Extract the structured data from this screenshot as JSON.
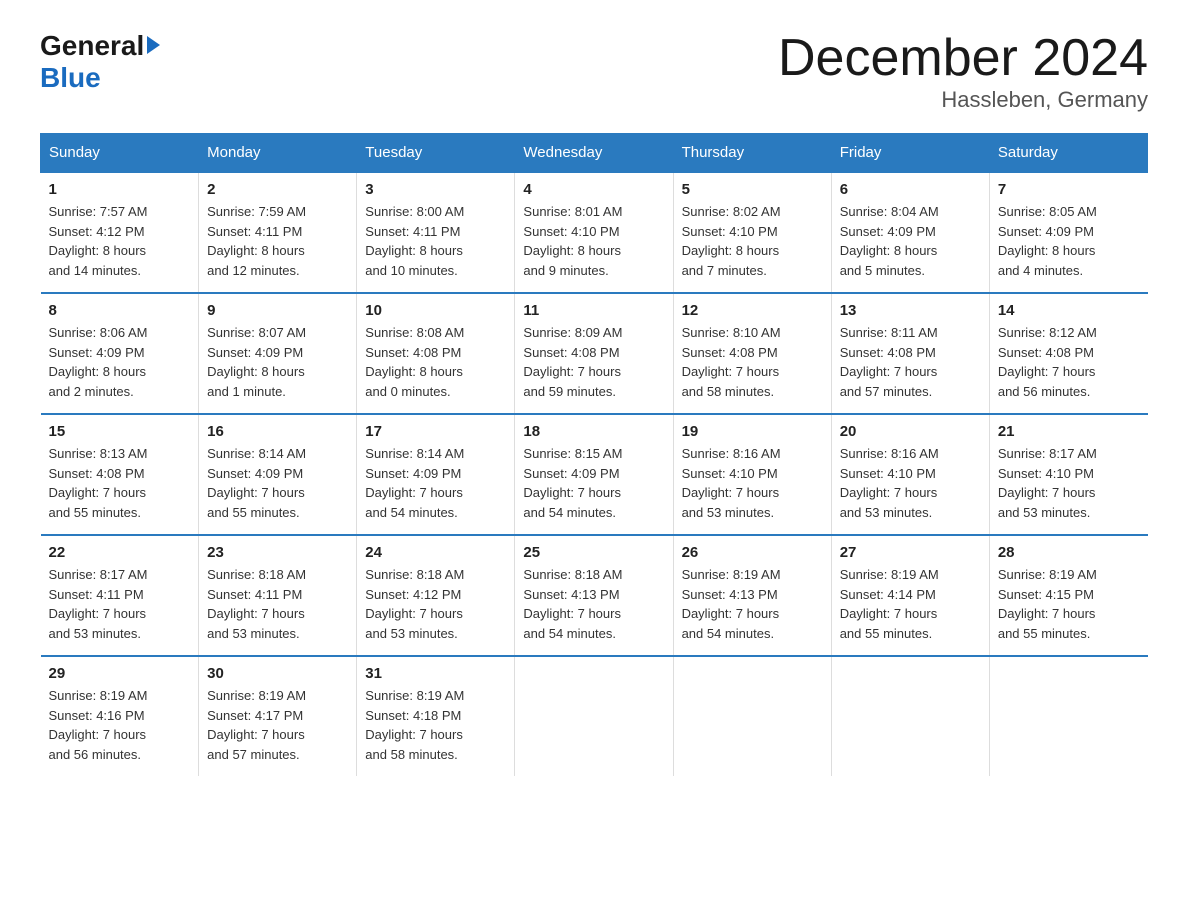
{
  "logo": {
    "general": "General",
    "blue": "Blue"
  },
  "title": "December 2024",
  "location": "Hassleben, Germany",
  "weekdays": [
    "Sunday",
    "Monday",
    "Tuesday",
    "Wednesday",
    "Thursday",
    "Friday",
    "Saturday"
  ],
  "weeks": [
    [
      {
        "day": "1",
        "sunrise": "7:57 AM",
        "sunset": "4:12 PM",
        "daylight": "8 hours and 14 minutes."
      },
      {
        "day": "2",
        "sunrise": "7:59 AM",
        "sunset": "4:11 PM",
        "daylight": "8 hours and 12 minutes."
      },
      {
        "day": "3",
        "sunrise": "8:00 AM",
        "sunset": "4:11 PM",
        "daylight": "8 hours and 10 minutes."
      },
      {
        "day": "4",
        "sunrise": "8:01 AM",
        "sunset": "4:10 PM",
        "daylight": "8 hours and 9 minutes."
      },
      {
        "day": "5",
        "sunrise": "8:02 AM",
        "sunset": "4:10 PM",
        "daylight": "8 hours and 7 minutes."
      },
      {
        "day": "6",
        "sunrise": "8:04 AM",
        "sunset": "4:09 PM",
        "daylight": "8 hours and 5 minutes."
      },
      {
        "day": "7",
        "sunrise": "8:05 AM",
        "sunset": "4:09 PM",
        "daylight": "8 hours and 4 minutes."
      }
    ],
    [
      {
        "day": "8",
        "sunrise": "8:06 AM",
        "sunset": "4:09 PM",
        "daylight": "8 hours and 2 minutes."
      },
      {
        "day": "9",
        "sunrise": "8:07 AM",
        "sunset": "4:09 PM",
        "daylight": "8 hours and 1 minute."
      },
      {
        "day": "10",
        "sunrise": "8:08 AM",
        "sunset": "4:08 PM",
        "daylight": "8 hours and 0 minutes."
      },
      {
        "day": "11",
        "sunrise": "8:09 AM",
        "sunset": "4:08 PM",
        "daylight": "7 hours and 59 minutes."
      },
      {
        "day": "12",
        "sunrise": "8:10 AM",
        "sunset": "4:08 PM",
        "daylight": "7 hours and 58 minutes."
      },
      {
        "day": "13",
        "sunrise": "8:11 AM",
        "sunset": "4:08 PM",
        "daylight": "7 hours and 57 minutes."
      },
      {
        "day": "14",
        "sunrise": "8:12 AM",
        "sunset": "4:08 PM",
        "daylight": "7 hours and 56 minutes."
      }
    ],
    [
      {
        "day": "15",
        "sunrise": "8:13 AM",
        "sunset": "4:08 PM",
        "daylight": "7 hours and 55 minutes."
      },
      {
        "day": "16",
        "sunrise": "8:14 AM",
        "sunset": "4:09 PM",
        "daylight": "7 hours and 55 minutes."
      },
      {
        "day": "17",
        "sunrise": "8:14 AM",
        "sunset": "4:09 PM",
        "daylight": "7 hours and 54 minutes."
      },
      {
        "day": "18",
        "sunrise": "8:15 AM",
        "sunset": "4:09 PM",
        "daylight": "7 hours and 54 minutes."
      },
      {
        "day": "19",
        "sunrise": "8:16 AM",
        "sunset": "4:10 PM",
        "daylight": "7 hours and 53 minutes."
      },
      {
        "day": "20",
        "sunrise": "8:16 AM",
        "sunset": "4:10 PM",
        "daylight": "7 hours and 53 minutes."
      },
      {
        "day": "21",
        "sunrise": "8:17 AM",
        "sunset": "4:10 PM",
        "daylight": "7 hours and 53 minutes."
      }
    ],
    [
      {
        "day": "22",
        "sunrise": "8:17 AM",
        "sunset": "4:11 PM",
        "daylight": "7 hours and 53 minutes."
      },
      {
        "day": "23",
        "sunrise": "8:18 AM",
        "sunset": "4:11 PM",
        "daylight": "7 hours and 53 minutes."
      },
      {
        "day": "24",
        "sunrise": "8:18 AM",
        "sunset": "4:12 PM",
        "daylight": "7 hours and 53 minutes."
      },
      {
        "day": "25",
        "sunrise": "8:18 AM",
        "sunset": "4:13 PM",
        "daylight": "7 hours and 54 minutes."
      },
      {
        "day": "26",
        "sunrise": "8:19 AM",
        "sunset": "4:13 PM",
        "daylight": "7 hours and 54 minutes."
      },
      {
        "day": "27",
        "sunrise": "8:19 AM",
        "sunset": "4:14 PM",
        "daylight": "7 hours and 55 minutes."
      },
      {
        "day": "28",
        "sunrise": "8:19 AM",
        "sunset": "4:15 PM",
        "daylight": "7 hours and 55 minutes."
      }
    ],
    [
      {
        "day": "29",
        "sunrise": "8:19 AM",
        "sunset": "4:16 PM",
        "daylight": "7 hours and 56 minutes."
      },
      {
        "day": "30",
        "sunrise": "8:19 AM",
        "sunset": "4:17 PM",
        "daylight": "7 hours and 57 minutes."
      },
      {
        "day": "31",
        "sunrise": "8:19 AM",
        "sunset": "4:18 PM",
        "daylight": "7 hours and 58 minutes."
      },
      null,
      null,
      null,
      null
    ]
  ],
  "labels": {
    "sunrise": "Sunrise:",
    "sunset": "Sunset:",
    "daylight": "Daylight:"
  }
}
